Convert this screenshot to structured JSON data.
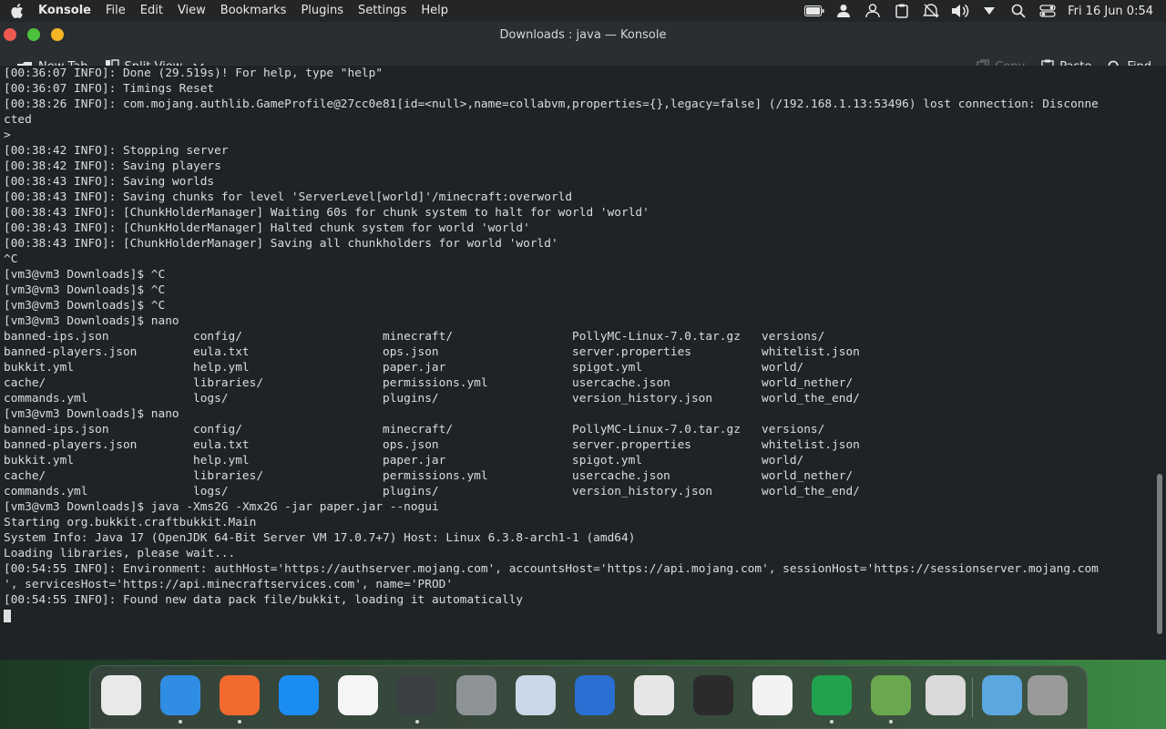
{
  "menubar": {
    "app_name": "Konsole",
    "menus": [
      "File",
      "Edit",
      "View",
      "Bookmarks",
      "Plugins",
      "Settings",
      "Help"
    ],
    "clock": "Fri 16 Jun 0:54"
  },
  "window": {
    "title": "Downloads : java — Konsole"
  },
  "toolbar": {
    "new_tab": "New Tab",
    "split_view": "Split View",
    "copy": "Copy",
    "paste": "Paste",
    "find": "Find"
  },
  "terminal": {
    "lines_before": [
      "[00:36:07 INFO]: Done (29.519s)! For help, type \"help\"",
      "[00:36:07 INFO]: Timings Reset",
      "[00:38:26 INFO]: com.mojang.authlib.GameProfile@27cc0e81[id=<null>,name=collabvm,properties={},legacy=false] (/192.168.1.13:53496) lost connection: Disconne",
      "cted",
      ">",
      "[00:38:42 INFO]: Stopping server",
      "[00:38:42 INFO]: Saving players",
      "[00:38:43 INFO]: Saving worlds",
      "[00:38:43 INFO]: Saving chunks for level 'ServerLevel[world]'/minecraft:overworld",
      "[00:38:43 INFO]: [ChunkHolderManager] Waiting 60s for chunk system to halt for world 'world'",
      "[00:38:43 INFO]: [ChunkHolderManager] Halted chunk system for world 'world'",
      "[00:38:43 INFO]: [ChunkHolderManager] Saving all chunkholders for world 'world'",
      "^C",
      "[vm3@vm3 Downloads]$ ^C",
      "[vm3@vm3 Downloads]$ ^C",
      "[vm3@vm3 Downloads]$ ^C",
      "[vm3@vm3 Downloads]$ nano"
    ],
    "listing1": [
      [
        "banned-ips.json",
        "config/",
        "minecraft/",
        "PollyMC-Linux-7.0.tar.gz",
        "versions/"
      ],
      [
        "banned-players.json",
        "eula.txt",
        "ops.json",
        "server.properties",
        "whitelist.json"
      ],
      [
        "bukkit.yml",
        "help.yml",
        "paper.jar",
        "spigot.yml",
        "world/"
      ],
      [
        "cache/",
        "libraries/",
        "permissions.yml",
        "usercache.json",
        "world_nether/"
      ],
      [
        "commands.yml",
        "logs/",
        "plugins/",
        "version_history.json",
        "world_the_end/"
      ]
    ],
    "middle_line": "[vm3@vm3 Downloads]$ nano",
    "listing2": [
      [
        "banned-ips.json",
        "config/",
        "minecraft/",
        "PollyMC-Linux-7.0.tar.gz",
        "versions/"
      ],
      [
        "banned-players.json",
        "eula.txt",
        "ops.json",
        "server.properties",
        "whitelist.json"
      ],
      [
        "bukkit.yml",
        "help.yml",
        "paper.jar",
        "spigot.yml",
        "world/"
      ],
      [
        "cache/",
        "libraries/",
        "permissions.yml",
        "usercache.json",
        "world_nether/"
      ],
      [
        "commands.yml",
        "logs/",
        "plugins/",
        "version_history.json",
        "world_the_end/"
      ]
    ],
    "lines_after": [
      "[vm3@vm3 Downloads]$ java -Xms2G -Xmx2G -jar paper.jar --nogui",
      "Starting org.bukkit.craftbukkit.Main",
      "System Info: Java 17 (OpenJDK 64-Bit Server VM 17.0.7+7) Host: Linux 6.3.8-arch1-1 (amd64)",
      "Loading libraries, please wait...",
      "[00:54:55 INFO]: Environment: authHost='https://authserver.mojang.com', accountsHost='https://api.mojang.com', sessionHost='https://sessionserver.mojang.com",
      "', servicesHost='https://api.minecraftservices.com', name='PROD'",
      "[00:54:55 INFO]: Found new data pack file/bukkit, loading it automatically"
    ]
  },
  "dock": {
    "items": [
      {
        "name": "launchpad-icon",
        "color": "#e9e9ea",
        "running": false
      },
      {
        "name": "finder-icon",
        "color": "#2f8de4",
        "running": true
      },
      {
        "name": "firefox-icon",
        "color": "#f26a2e",
        "running": true
      },
      {
        "name": "app-store-icon",
        "color": "#1b8cf2",
        "running": false
      },
      {
        "name": "photos-icon",
        "color": "#f5f5f5",
        "running": false
      },
      {
        "name": "terminal-icon",
        "color": "#3b4045",
        "running": true
      },
      {
        "name": "system-settings-icon",
        "color": "#8e9397",
        "running": false
      },
      {
        "name": "preview-icon",
        "color": "#c9d7e6",
        "running": false
      },
      {
        "name": "text-editor-icon",
        "color": "#2a6fd1",
        "running": false
      },
      {
        "name": "image-viewer-icon",
        "color": "#e6e6e6",
        "running": false
      },
      {
        "name": "media-player-icon",
        "color": "#2b2b2b",
        "running": false
      },
      {
        "name": "notes-icon",
        "color": "#f2f2f2",
        "running": false
      },
      {
        "name": "polymc-icon",
        "color": "#23a24d",
        "running": true
      },
      {
        "name": "minecraft-icon",
        "color": "#6aa84f",
        "running": true
      },
      {
        "name": "calculator-icon",
        "color": "#d9d9d9",
        "running": false
      },
      {
        "name": "downloads-folder-icon",
        "color": "#5ba7e0",
        "running": false
      },
      {
        "name": "trash-icon",
        "color": "#9a9a9a",
        "running": false
      }
    ]
  }
}
